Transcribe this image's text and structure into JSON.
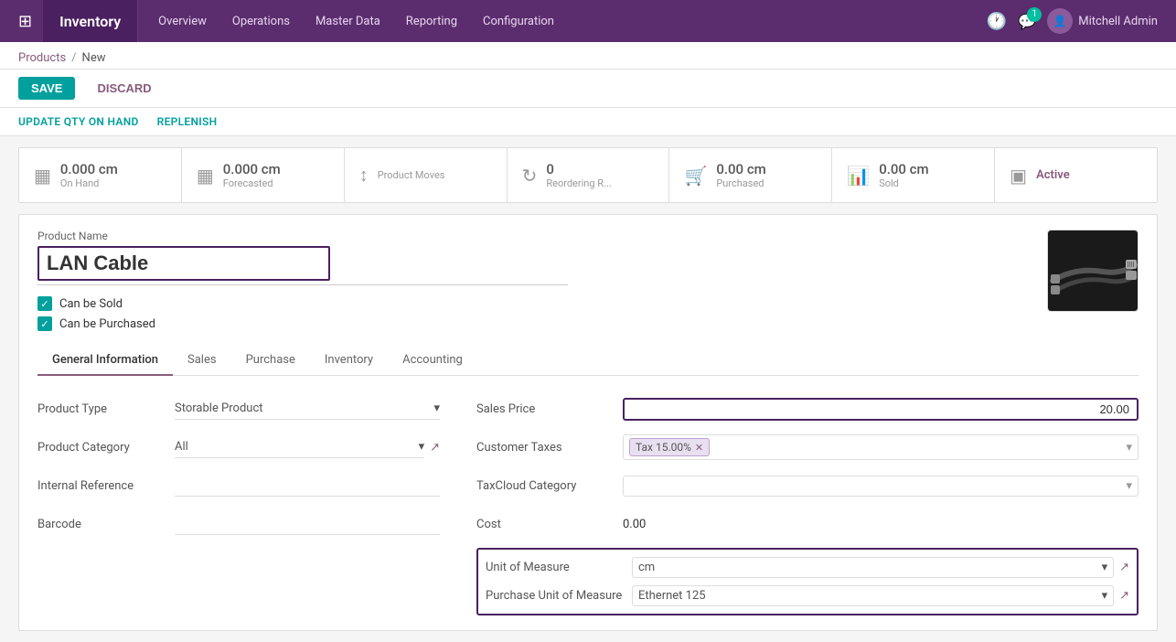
{
  "app": {
    "title": "Inventory",
    "nav_items": [
      "Overview",
      "Operations",
      "Master Data",
      "Reporting",
      "Configuration"
    ],
    "user": "Mitchell Admin",
    "chat_badge": "1"
  },
  "breadcrumb": {
    "parent": "Products",
    "current": "New"
  },
  "actions": {
    "save": "SAVE",
    "discard": "DISCARD",
    "update_qty": "UPDATE QTY ON HAND",
    "replenish": "REPLENISH"
  },
  "stats": [
    {
      "icon": "grid",
      "value": "0.000 cm",
      "label": "On Hand"
    },
    {
      "icon": "grid",
      "value": "0.000 cm",
      "label": "Forecasted"
    },
    {
      "icon": "arrow-updown",
      "value": "",
      "label": "Product Moves"
    },
    {
      "icon": "refresh",
      "value": "0",
      "label": "Reordering R..."
    },
    {
      "icon": "cart",
      "value": "0.00 cm",
      "label": "Purchased"
    },
    {
      "icon": "bar-chart",
      "value": "0.00 cm",
      "label": "Sold"
    },
    {
      "icon": "toggle",
      "value": "Active",
      "label": ""
    }
  ],
  "product": {
    "name_label": "Product Name",
    "name_value": "LAN Cable",
    "can_be_sold": true,
    "can_be_sold_label": "Can be Sold",
    "can_be_purchased": true,
    "can_be_purchased_label": "Can be Purchased"
  },
  "tabs": [
    {
      "id": "general",
      "label": "General Information",
      "active": true
    },
    {
      "id": "sales",
      "label": "Sales",
      "active": false
    },
    {
      "id": "purchase",
      "label": "Purchase",
      "active": false
    },
    {
      "id": "inventory",
      "label": "Inventory",
      "active": false
    },
    {
      "id": "accounting",
      "label": "Accounting",
      "active": false
    }
  ],
  "general_info": {
    "left": {
      "product_type_label": "Product Type",
      "product_type_value": "Storable Product",
      "product_category_label": "Product Category",
      "product_category_value": "All",
      "internal_reference_label": "Internal Reference",
      "internal_reference_value": "",
      "barcode_label": "Barcode",
      "barcode_value": ""
    },
    "right": {
      "sales_price_label": "Sales Price",
      "sales_price_value": "20.00",
      "customer_taxes_label": "Customer Taxes",
      "customer_taxes_value": "Tax 15.00%",
      "taxcloud_category_label": "TaxCloud Category",
      "taxcloud_category_value": "",
      "cost_label": "Cost",
      "cost_value": "0.00",
      "uom_label": "Unit of Measure",
      "uom_value": "cm",
      "purchase_uom_label": "Purchase Unit of Measure",
      "purchase_uom_value": "Ethernet 125"
    }
  }
}
